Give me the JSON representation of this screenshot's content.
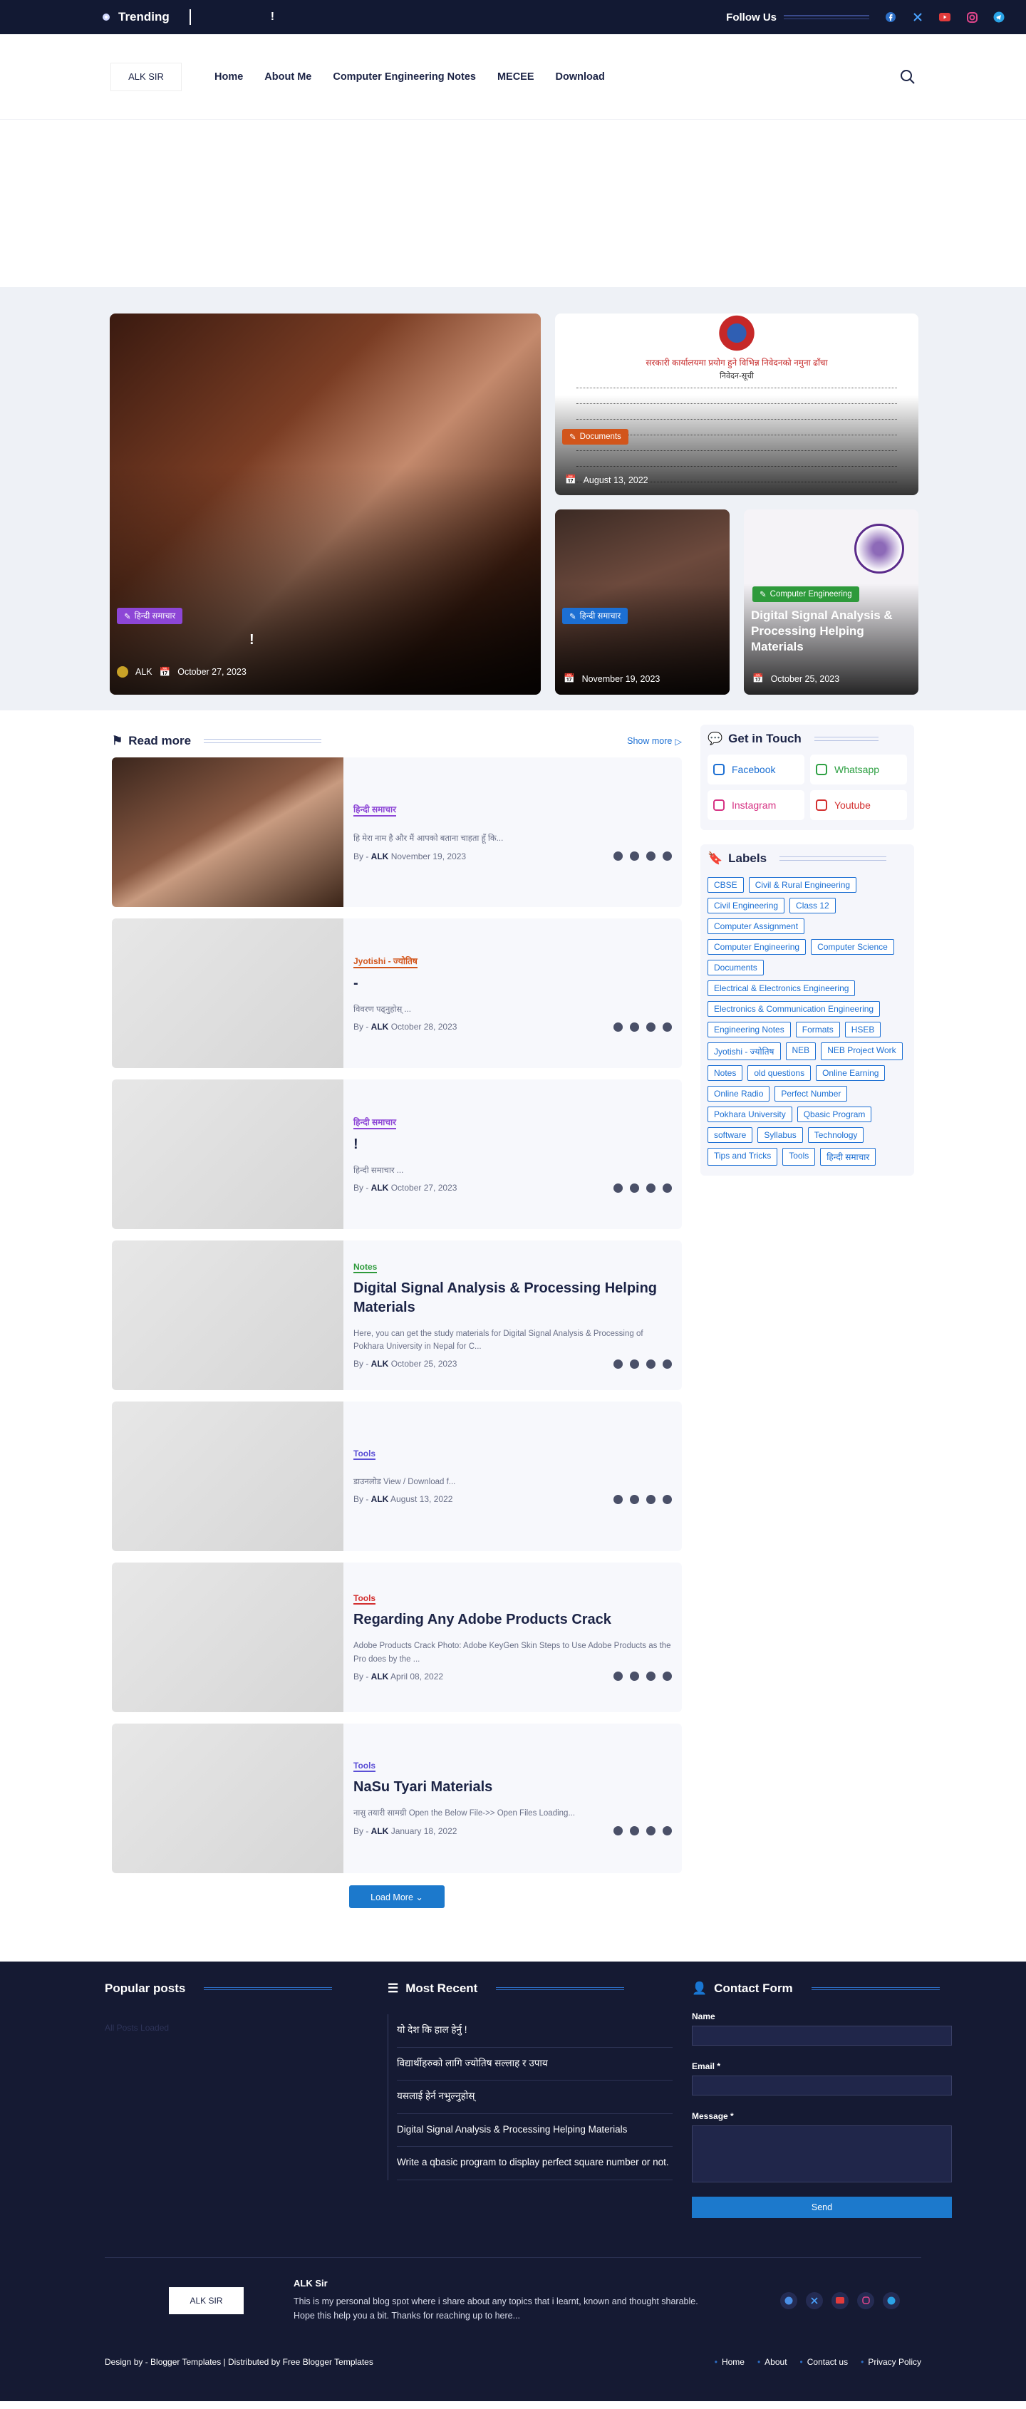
{
  "topbar": {
    "trending": "Trending",
    "ticker": "!",
    "follow": "Follow Us"
  },
  "nav": {
    "logo": "ALK SIR",
    "items": [
      "Home",
      "About Me",
      "Computer Engineering Notes",
      "MECEE",
      "Download"
    ]
  },
  "hero": {
    "big": {
      "tag": "हिन्दी समाचार",
      "title": "!",
      "author": "ALK",
      "date": "October 27, 2023"
    },
    "doc": {
      "tag": "Documents",
      "date": "August 13, 2022"
    },
    "girl": {
      "tag": "हिन्दी समाचार",
      "date": "November 19, 2023"
    },
    "notes": {
      "tag": "Computer Engineering",
      "title": "Digital Signal Analysis & Processing Helping Materials",
      "date": "October 25, 2023"
    }
  },
  "readmore": {
    "title": "Read more",
    "show": "Show more"
  },
  "posts": [
    {
      "cat": "हिन्दी समाचार",
      "title": "",
      "excerpt": "हि मेरा नाम है और मैं आपको बताना चाहता हूँ कि...",
      "author": "ALK",
      "date": "November 19, 2023"
    },
    {
      "cat": "Jyotishi - ज्योतिष",
      "title": "-",
      "excerpt": "विवरण पढ्नुहोस् ...",
      "author": "ALK",
      "date": "October 28, 2023"
    },
    {
      "cat": "हिन्दी समाचार",
      "title": "!",
      "excerpt": "हिन्दी समाचार ...",
      "author": "ALK",
      "date": "October 27, 2023"
    },
    {
      "cat": "Notes",
      "title": "Digital Signal Analysis & Processing Helping Materials",
      "excerpt": "Here, you can get the study materials for Digital Signal Analysis & Processing of Pokhara University in Nepal for C...",
      "author": "ALK",
      "date": "October 25, 2023"
    },
    {
      "cat": "Tools",
      "title": "",
      "excerpt": "डाउनलोड View / Download f...",
      "author": "ALK",
      "date": "August 13, 2022"
    },
    {
      "cat": "Tools",
      "title": "Regarding Any Adobe Products Crack",
      "excerpt": "Adobe Products Crack Photo: Adobe KeyGen Skin Steps to Use Adobe Products as the Pro does by the ...",
      "author": "ALK",
      "date": "April 08, 2022"
    },
    {
      "cat": "Tools",
      "title": "NaSu Tyari Materials",
      "excerpt": "नासु तयारी सामग्री Open the Below File->> Open Files Loading...",
      "author": "ALK",
      "date": "January 18, 2022"
    }
  ],
  "loadmore": "Load More",
  "touch": {
    "title": "Get in Touch",
    "items": [
      {
        "label": "Facebook",
        "color": "#1c6fd3"
      },
      {
        "label": "Whatsapp",
        "color": "#2ea043"
      },
      {
        "label": "Instagram",
        "color": "#d63384"
      },
      {
        "label": "Youtube",
        "color": "#d32f2f"
      }
    ]
  },
  "labels": {
    "title": "Labels",
    "items": [
      "CBSE",
      "Civil & Rural Engineering",
      "Civil Engineering",
      "Class 12",
      "Computer Assignment",
      "Computer Engineering",
      "Computer Science",
      "Documents",
      "Electrical & Electronics Engineering",
      "Electronics & Communication Engineering",
      "Engineering Notes",
      "Formats",
      "HSEB",
      "Jyotishi - ज्योतिष",
      "NEB",
      "NEB Project Work",
      "Notes",
      "old questions",
      "Online Earning",
      "Online Radio",
      "Perfect Number",
      "Pokhara University",
      "Qbasic Program",
      "software",
      "Syllabus",
      "Technology",
      "Tips and Tricks",
      "Tools",
      "हिन्दी समाचार"
    ]
  },
  "footer": {
    "popular": "Popular posts",
    "ghost": "All Posts Loaded",
    "recent_title": "Most Recent",
    "recent": [
      "यो देश कि हाल हेर्नु !",
      "विद्यार्थीहरुको लागि ज्योतिष सल्लाह र उपाय",
      "यसलाई हेर्न नभुल्नुहोस्",
      "Digital Signal Analysis & Processing Helping Materials",
      "Write a qbasic program to display perfect square number or not."
    ],
    "contact_title": "Contact Form",
    "name": "Name",
    "email": "Email *",
    "message": "Message *",
    "send": "Send",
    "site": "ALK Sir",
    "about": "This is my personal blog spot where i share about any topics that i learnt, known and thought sharable. Hope this help you a bit. Thanks for reaching up to here...",
    "design": "Design by - Blogger Templates | Distributed by Free Blogger Templates",
    "links": [
      "Home",
      "About",
      "Contact us",
      "Privacy Policy"
    ]
  }
}
